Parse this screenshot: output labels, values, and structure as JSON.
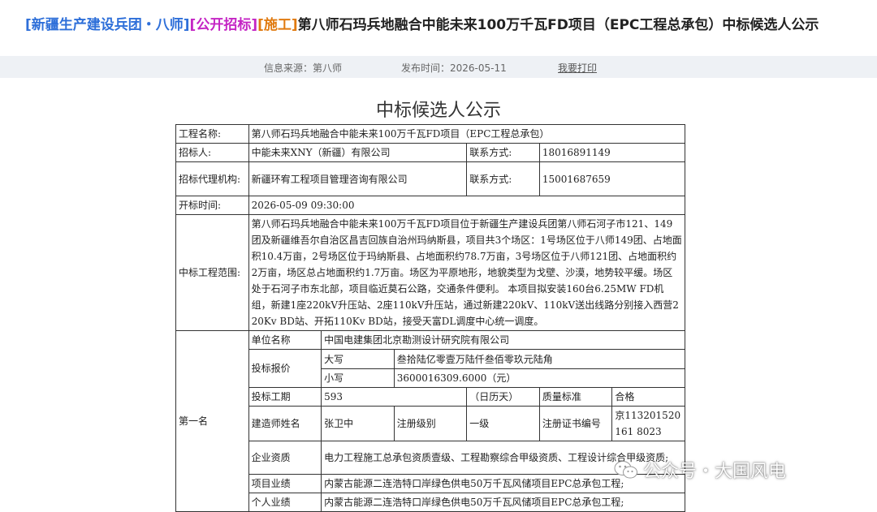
{
  "header": {
    "tag_org": "[新疆生产建设兵团・八师]",
    "tag_type": "[公开招标]",
    "tag_category": "[施工]",
    "title": "第八师石玛兵地融合中能未来100万千瓦FD项目（EPC工程总承包）中标候选人公示"
  },
  "meta": {
    "source": "信息来源：第八师",
    "publish_time": "发布时间：2026-05-11",
    "print_label": "我要打印"
  },
  "doc": {
    "heading": "中标候选人公示",
    "project_name_label": "工程名称:",
    "project_name": "第八师石玛兵地融合中能未来100万千瓦FD项目（EPC工程总承包）",
    "tenderer_label": "招标人:",
    "tenderer": "中能未来XNY（新疆）有限公司",
    "contact_label": "联系方式:",
    "tenderer_phone": "18016891149",
    "agent_label": "招标代理机构:",
    "agent": "新疆环宥工程项目管理咨询有限公司",
    "agent_phone": "15001687659",
    "open_time_label": "开标时间:",
    "open_time": "2026-05-09 09:30:00",
    "scope_label": "中标工程范围:",
    "scope": "第八师石玛兵地融合中能未来100万千瓦FD项目位于新疆生产建设兵团第八师石河子市121、149团及新疆维吾尔自治区昌吉回族自治州玛纳斯县，项目共3个场区：1号场区位于八师149团、占地面积10.4万亩，2号场区位于玛纳斯县、占地面积约78.7万亩，3号场区位于八师121团、占地面积约2万亩，场区总占地面积约1.7万亩。场区为平原地形，地貌类型为戈壁、沙漠，地势较平缓。场区处于石河子市东北部，项目临近莫石公路，交通条件便利。 本项目拟安装160台6.25MW FD机组，新建1座220kV升压站、2座110kV升压站，通过新建220kV、110kV送出线路分别接入西营220Kv BD站、开拓110Kv BD站，接受天富DL调度中心统一调度。",
    "rank_label": "第一名",
    "unit_label": "单位名称",
    "unit": "中国电建集团北京勘测设计研究院有限公司",
    "bid_price_label": "投标报价",
    "upper_label": "大写",
    "upper_value": "叁拾陆亿零壹万陆仟叁佰零玖元陆角",
    "lower_label": "小写",
    "lower_value": "3600016309.6000（元）",
    "period_label": "投标工期",
    "period": "593",
    "period_unit": "（日历天）",
    "quality_label": "质量标准",
    "quality": "合格",
    "engineer_label": "建造师姓名",
    "engineer": "张卫中",
    "reg_level_label": "注册级别",
    "reg_level": "一级",
    "cert_label": "注册证书编号",
    "cert": "京113201520161 8023",
    "qual_label": "企业资质",
    "qual": "电力工程施工总承包资质壹级、工程勘察综合甲级资质、工程设计综合甲级资质;",
    "perf_label": "项目业绩",
    "perf": "内蒙古能源二连浩特口岸绿色供电50万千瓦风储项目EPC总承包工程;",
    "personal_label": "个人业绩",
    "personal": "内蒙古能源二连浩特口岸绿色供电50万千瓦风储项目EPC总承包工程;"
  },
  "watermark": {
    "text": "公众号・大国风电",
    "icon": "wechat-icon"
  }
}
